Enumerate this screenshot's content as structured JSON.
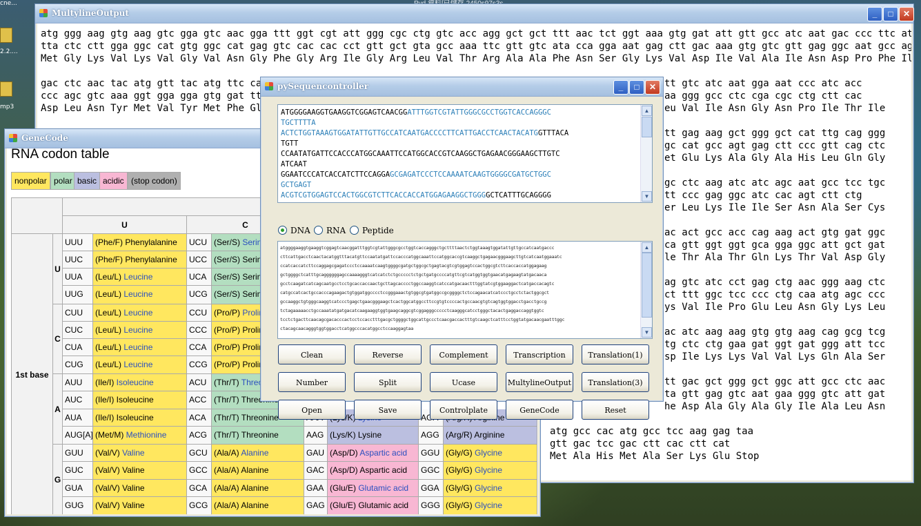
{
  "desktop": {
    "top_text": "Pvd      資料[已儲存 2450s97s3s…",
    "icon_labels": [
      "2.2....",
      "mp3",
      "cne..."
    ]
  },
  "multyline": {
    "title": "MultylineOutput",
    "lines": [
      "atg ggg aag gtg aag gtc gga gtc aac gga ttt ggt cgt att ggg cgc ctg gtc acc agg gct gct ttt aac tct ggt aaa gtg gat att gtt gcc atc aat gac ccc ttc att",
      "tta ctc ctt gga ggc cat gtg ggc cat gag gtc cac cac cct gtt gct gta gcc aaa ttc gtt gtc ata cca gga aat gag ctt gac aaa gtg gtc gtt gag ggc aat gcc agc",
      "Met Gly Lys Val Lys Val Gly Val Asn Gly Phe Gly Arg Ile Gly Arg Leu Val Thr Arg Ala Ala Phe Asn Ser Gly Lys Val Asp Ile Val Ala Ile Asn Asp Pro Phe Ile",
      "gac ctc aac tac atg gtt tac atg ttc caa",
      "ccc agc gtc aaa ggt gga gga gtg gat ttg",
      "Asp Leu Asn Tyr Met Val Tyr Met Phe Gln",
      "atg gcc cac atg gcc tcc aag gag taa",
      "gtt gac tcc gac ctt cac ctt cat",
      "Met Ala His Met Ala Ser Lys Glu Stop"
    ],
    "right_lines": [
      "tt gtc atc aat gga aat ccc atc acc",
      "aa ggg gcc ctc cga cgc ctg ctt cac",
      "eu Val Ile Asn Gly Asn Pro Ile Thr Ile",
      "tt gag aag gct ggg gct cat ttg cag ggg",
      "gc cat gcc agt gag ctt ccc gtt cag ctc",
      "et Glu Lys Ala Gly Ala His Leu Gln Gly",
      "gc ctc aag atc atc agc aat gcc tcc tgc",
      "tt ccc gag ggc atc cac agt ctt ctg",
      "er Leu Lys Ile Ile Ser Asn Ala Ser Cys",
      "ac act gcc acc cag aag act gtg gat ggc",
      "ca gtt ggt ggt gca gga ggc att gct gat",
      "le Thr Ala Thr Gln Lys Thr Val Asp Gly",
      "ag gtc atc cct gag ctg aac ggg aag ctc",
      "ct ttt ggc tcc ccc ctg caa atg agc ccc",
      "ys Val Ile Pro Glu Leu Asn Gly Lys Leu",
      "ac atc aag aag gtg gtg aag cag gcg tcg",
      "tg ctc ctg gaa gat ggt gat ggg att tcc",
      "sp Ile Lys Lys Val Val Lys Gln Ala Ser",
      "tt gac gct ggg gct ggc att gcc ctc aac",
      "ta gtt gag gtc aat gaa ggg gtc att gat",
      "he Asp Ala Gly Ala Gly Ile Ala Leu Asn"
    ]
  },
  "genecode": {
    "title": "GeneCode",
    "heading": "RNA codon table",
    "legend": [
      "nonpolar",
      "polar",
      "basic",
      "acidic",
      "(stop codon)"
    ],
    "col_headers": [
      "U",
      "C"
    ],
    "first_base_label": "1st base",
    "row_groups": [
      "U",
      "C",
      "A",
      "G"
    ],
    "rows": [
      {
        "c1": "UUU",
        "a1": "(Phe/F) Phenylalanine",
        "c2": "UCU",
        "a2": "(Ser/S) Serine"
      },
      {
        "c1": "UUC",
        "a1": "(Phe/F) Phenylalanine",
        "c2": "UCC",
        "a2": "(Ser/S) Serine"
      },
      {
        "c1": "UUA",
        "a1": "(Leu/L) Leucine",
        "c2": "UCA",
        "a2": "(Ser/S) Serine"
      },
      {
        "c1": "UUG",
        "a1": "(Leu/L) Leucine",
        "c2": "UCG",
        "a2": "(Ser/S) Serine"
      },
      {
        "c1": "CUU",
        "a1": "(Leu/L) Leucine",
        "c2": "CCU",
        "a2": "(Pro/P) Proline"
      },
      {
        "c1": "CUC",
        "a1": "(Leu/L) Leucine",
        "c2": "CCC",
        "a2": "(Pro/P) Proline"
      },
      {
        "c1": "CUA",
        "a1": "(Leu/L) Leucine",
        "c2": "CCA",
        "a2": "(Pro/P) Proline"
      },
      {
        "c1": "CUG",
        "a1": "(Leu/L) Leucine",
        "c2": "CCG",
        "a2": "(Pro/P) Proline"
      },
      {
        "c1": "AUU",
        "a1": "(Ile/I) Isoleucine",
        "c2": "ACU",
        "a2": "(Thr/T) Threonine"
      },
      {
        "c1": "AUC",
        "a1": "(Ile/I) Isoleucine",
        "c2": "ACC",
        "a2": "(Thr/T) Threonine"
      },
      {
        "c1": "AUA",
        "a1": "(Ile/I) Isoleucine",
        "c2": "ACA",
        "a2": "(Thr/T) Threonine",
        "c3": "AAA",
        "a3": "(Lys/K) Lysine",
        "c4": "AGA",
        "a4": "(Arg/R) Arginine"
      },
      {
        "c1": "AUG[A]",
        "a1": "(Met/M) Methionine",
        "c2": "ACG",
        "a2": "(Thr/T) Threonine",
        "c3": "AAG",
        "a3": "(Lys/K) Lysine",
        "c4": "AGG",
        "a4": "(Arg/R) Arginine"
      },
      {
        "c1": "GUU",
        "a1": "(Val/V) Valine",
        "c2": "GCU",
        "a2": "(Ala/A) Alanine",
        "c3": "GAU",
        "a3": "(Asp/D) Aspartic acid",
        "c4": "GGU",
        "a4": "(Gly/G) Glycine"
      },
      {
        "c1": "GUC",
        "a1": "(Val/V) Valine",
        "c2": "GCC",
        "a2": "(Ala/A) Alanine",
        "c3": "GAC",
        "a3": "(Asp/D) Aspartic acid",
        "c4": "GGC",
        "a4": "(Gly/G) Glycine"
      },
      {
        "c1": "GUA",
        "a1": "(Val/V) Valine",
        "c2": "GCA",
        "a2": "(Ala/A) Alanine",
        "c3": "GAA",
        "a3": "(Glu/E) Glutamic acid",
        "c4": "GGA",
        "a4": "(Gly/G) Glycine"
      },
      {
        "c1": "GUG",
        "a1": "(Val/V) Valine",
        "c2": "GCG",
        "a2": "(Ala/A) Alanine",
        "c3": "GAG",
        "a3": "(Glu/E) Glutamic acid",
        "c4": "GGG",
        "a4": "(Gly/G) Glycine"
      }
    ]
  },
  "pyseq": {
    "title": "pySequencontroller",
    "seq_lines": [
      [
        "ATGGGGAAGGTGAAGGTCGGAGTCAACGG",
        "ATTTGGTCGTATTGGGCGCCTGGTCACCAGGGC"
      ],
      [
        "",
        "TGCTTTTA"
      ],
      [
        "",
        "ACTCTGGTAAAGTGGATATTGTTGCCATCAATGACCCCTTCATTGACCTCAACTACATG",
        "GTTTACA"
      ],
      [
        "TGTT"
      ],
      [
        "CCAATATGATTCCACCCATGGCAAATTCCATGGCACCGTCAAGGCTGAGAACGGGAAGCTTGTC"
      ],
      [
        "ATCAAT"
      ],
      [
        "GGAATCCCATCACCATCTTCCAGGA",
        "GCGAGATCCCTCCAAAATCAAGTGGGGCGATGCTGGC"
      ],
      [
        "",
        "GCTGAGT"
      ],
      [
        "",
        "ACGTCGTGGAGTCCACTGGCGTCTTCACCACCATGGAGAAGGCTGGG",
        "GCTCATTTGCAGGGG"
      ]
    ],
    "radio_dna": "DNA",
    "radio_rna": "RNA",
    "radio_peptide": "Peptide",
    "lower_lines": [
      "atggggaaggtgaaggtcggagtcaacggatttggtcgtattgggcgcctggtcaccagggctgcttttaactctggtaaagtggatattgttgccatcaatgaccc",
      "cttcattgacctcaactacatggtttacatgttccaatatgattccacccatggcaaattccatggcaccgtcaaggctgagaacgggaagcttgtcatcaatggaaatc",
      "ccatcaccatcttccaggagcgagatccctccaaaatcaagtggggcgatgctggcgctgagtacgtcgtggagtccactggcgtcttcaccaccatggagaag",
      "gctggggctcatttgcaggggggagccaaaagggtcatcatctctgccccctctgctgatgccccatgttcgtcatggtggtgaacatgagaagtatgacaaca",
      "gcctcaagatcatcagcaatgcctcctgcaccaccaactgcttagcacccctggccaaggtcatccatgacaactttggtatcgtggaaggactcatgaccacagtc",
      "catgccatcactgccacccagaagactgtggatggcccctccgggaaactgtggcgtgatggccgcggggctctccagaacatcatccctgcctctactggcgct",
      "gccaaggctgtgggcaaggtcatccctgagctgaacgggaagctcactggcatggccttccgtgtccccactgccaacgtgtcagtggtggacctgacctgccg",
      "tctagaaaaacctgccaaatatgatgacatcaagaaggtggtgaagcaggcgtcggagggccccctcaagggcatcctgggctacactgaggaccaggtggtc",
      "tcctctgacttcaacagcgacacccactcctccacctttgacgctggggctggcattgccctcaacgaccactttgtcaagctcatttcctggtatgacaacgaatttggc",
      "ctacagcaacagggtggtggacctcatggcccacatggcctccaaggagtaa"
    ],
    "buttons": [
      "Clean",
      "Reverse",
      "Complement",
      "Transcription",
      "Translation(1)",
      "Number",
      "Split",
      "Ucase",
      "MultylineOutput",
      "Translation(3)",
      "Open",
      "Save",
      "Controlplate",
      "GeneCode",
      "Reset"
    ]
  }
}
